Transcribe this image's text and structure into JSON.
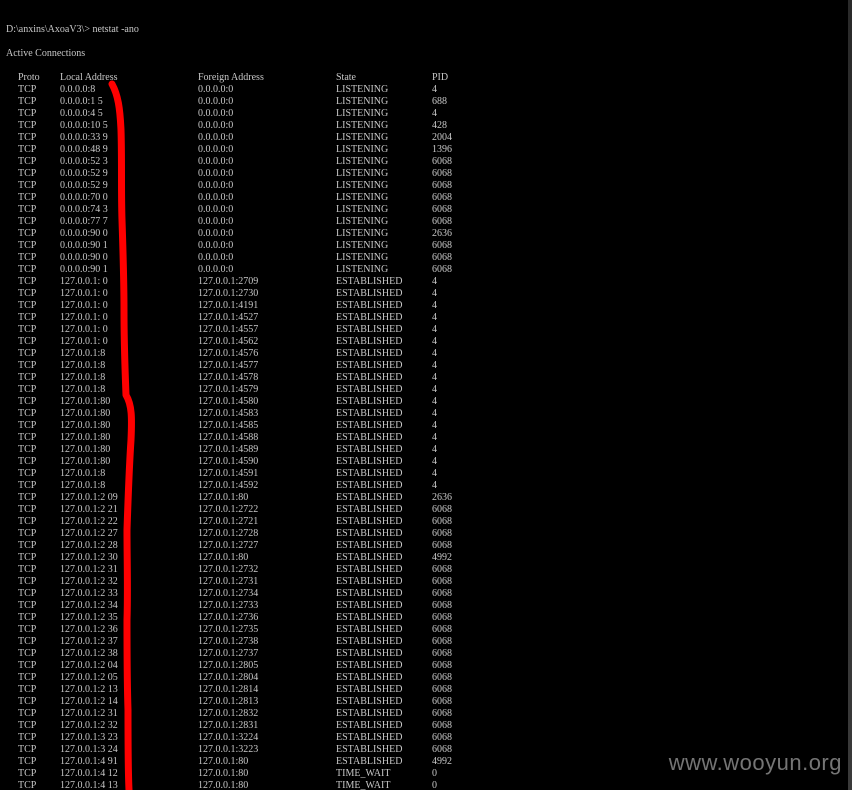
{
  "prompt_line": "D:\\anxins\\AxoaV3\\> netstat -ano",
  "section_title": "Active Connections",
  "headers": {
    "proto": "Proto",
    "local": "Local Address",
    "foreign": "Foreign Address",
    "state": "State",
    "pid": "PID"
  },
  "connections": [
    {
      "proto": "TCP",
      "local": "0.0.0.0:8",
      "foreign": "0.0.0.0:0",
      "state": "LISTENING",
      "pid": "4"
    },
    {
      "proto": "TCP",
      "local": "0.0.0.0:1 5",
      "foreign": "0.0.0.0:0",
      "state": "LISTENING",
      "pid": "688"
    },
    {
      "proto": "TCP",
      "local": "0.0.0.0:4 5",
      "foreign": "0.0.0.0:0",
      "state": "LISTENING",
      "pid": "4"
    },
    {
      "proto": "TCP",
      "local": "0.0.0.0:10 5",
      "foreign": "0.0.0.0:0",
      "state": "LISTENING",
      "pid": "428"
    },
    {
      "proto": "TCP",
      "local": "0.0.0.0:33 9",
      "foreign": "0.0.0.0:0",
      "state": "LISTENING",
      "pid": "2004"
    },
    {
      "proto": "TCP",
      "local": "0.0.0.0:48 9",
      "foreign": "0.0.0.0:0",
      "state": "LISTENING",
      "pid": "1396"
    },
    {
      "proto": "TCP",
      "local": "0.0.0.0:52 3",
      "foreign": "0.0.0.0:0",
      "state": "LISTENING",
      "pid": "6068"
    },
    {
      "proto": "TCP",
      "local": "0.0.0.0:52 9",
      "foreign": "0.0.0.0:0",
      "state": "LISTENING",
      "pid": "6068"
    },
    {
      "proto": "TCP",
      "local": "0.0.0.0:52 9",
      "foreign": "0.0.0.0:0",
      "state": "LISTENING",
      "pid": "6068"
    },
    {
      "proto": "TCP",
      "local": "0.0.0.0:70 0",
      "foreign": "0.0.0.0:0",
      "state": "LISTENING",
      "pid": "6068"
    },
    {
      "proto": "TCP",
      "local": "0.0.0.0:74 3",
      "foreign": "0.0.0.0:0",
      "state": "LISTENING",
      "pid": "6068"
    },
    {
      "proto": "TCP",
      "local": "0.0.0.0:77 7",
      "foreign": "0.0.0.0:0",
      "state": "LISTENING",
      "pid": "6068"
    },
    {
      "proto": "TCP",
      "local": "0.0.0.0:90 0",
      "foreign": "0.0.0.0:0",
      "state": "LISTENING",
      "pid": "2636"
    },
    {
      "proto": "TCP",
      "local": "0.0.0.0:90 1",
      "foreign": "0.0.0.0:0",
      "state": "LISTENING",
      "pid": "6068"
    },
    {
      "proto": "TCP",
      "local": "0.0.0.0:90 0",
      "foreign": "0.0.0.0:0",
      "state": "LISTENING",
      "pid": "6068"
    },
    {
      "proto": "TCP",
      "local": "0.0.0.0:90 1",
      "foreign": "0.0.0.0:0",
      "state": "LISTENING",
      "pid": "6068"
    },
    {
      "proto": "TCP",
      "local": "127.0.0.1: 0",
      "foreign": "127.0.0.1:2709",
      "state": "ESTABLISHED",
      "pid": "4"
    },
    {
      "proto": "TCP",
      "local": "127.0.0.1: 0",
      "foreign": "127.0.0.1:2730",
      "state": "ESTABLISHED",
      "pid": "4"
    },
    {
      "proto": "TCP",
      "local": "127.0.0.1: 0",
      "foreign": "127.0.0.1:4191",
      "state": "ESTABLISHED",
      "pid": "4"
    },
    {
      "proto": "TCP",
      "local": "127.0.0.1: 0",
      "foreign": "127.0.0.1:4527",
      "state": "ESTABLISHED",
      "pid": "4"
    },
    {
      "proto": "TCP",
      "local": "127.0.0.1: 0",
      "foreign": "127.0.0.1:4557",
      "state": "ESTABLISHED",
      "pid": "4"
    },
    {
      "proto": "TCP",
      "local": "127.0.0.1: 0",
      "foreign": "127.0.0.1:4562",
      "state": "ESTABLISHED",
      "pid": "4"
    },
    {
      "proto": "TCP",
      "local": "127.0.0.1:8",
      "foreign": "127.0.0.1:4576",
      "state": "ESTABLISHED",
      "pid": "4"
    },
    {
      "proto": "TCP",
      "local": "127.0.0.1:8",
      "foreign": "127.0.0.1:4577",
      "state": "ESTABLISHED",
      "pid": "4"
    },
    {
      "proto": "TCP",
      "local": "127.0.0.1:8",
      "foreign": "127.0.0.1:4578",
      "state": "ESTABLISHED",
      "pid": "4"
    },
    {
      "proto": "TCP",
      "local": "127.0.0.1:8",
      "foreign": "127.0.0.1:4579",
      "state": "ESTABLISHED",
      "pid": "4"
    },
    {
      "proto": "TCP",
      "local": "127.0.0.1:80",
      "foreign": "127.0.0.1:4580",
      "state": "ESTABLISHED",
      "pid": "4"
    },
    {
      "proto": "TCP",
      "local": "127.0.0.1:80",
      "foreign": "127.0.0.1:4583",
      "state": "ESTABLISHED",
      "pid": "4"
    },
    {
      "proto": "TCP",
      "local": "127.0.0.1:80",
      "foreign": "127.0.0.1:4585",
      "state": "ESTABLISHED",
      "pid": "4"
    },
    {
      "proto": "TCP",
      "local": "127.0.0.1:80",
      "foreign": "127.0.0.1:4588",
      "state": "ESTABLISHED",
      "pid": "4"
    },
    {
      "proto": "TCP",
      "local": "127.0.0.1:80",
      "foreign": "127.0.0.1:4589",
      "state": "ESTABLISHED",
      "pid": "4"
    },
    {
      "proto": "TCP",
      "local": "127.0.0.1:80",
      "foreign": "127.0.0.1:4590",
      "state": "ESTABLISHED",
      "pid": "4"
    },
    {
      "proto": "TCP",
      "local": "127.0.0.1:8",
      "foreign": "127.0.0.1:4591",
      "state": "ESTABLISHED",
      "pid": "4"
    },
    {
      "proto": "TCP",
      "local": "127.0.0.1:8",
      "foreign": "127.0.0.1:4592",
      "state": "ESTABLISHED",
      "pid": "4"
    },
    {
      "proto": "TCP",
      "local": "127.0.0.1:2 09",
      "foreign": "127.0.0.1:80",
      "state": "ESTABLISHED",
      "pid": "2636"
    },
    {
      "proto": "TCP",
      "local": "127.0.0.1:2 21",
      "foreign": "127.0.0.1:2722",
      "state": "ESTABLISHED",
      "pid": "6068"
    },
    {
      "proto": "TCP",
      "local": "127.0.0.1:2 22",
      "foreign": "127.0.0.1:2721",
      "state": "ESTABLISHED",
      "pid": "6068"
    },
    {
      "proto": "TCP",
      "local": "127.0.0.1:2 27",
      "foreign": "127.0.0.1:2728",
      "state": "ESTABLISHED",
      "pid": "6068"
    },
    {
      "proto": "TCP",
      "local": "127.0.0.1:2 28",
      "foreign": "127.0.0.1:2727",
      "state": "ESTABLISHED",
      "pid": "6068"
    },
    {
      "proto": "TCP",
      "local": "127.0.0.1:2 30",
      "foreign": "127.0.0.1:80",
      "state": "ESTABLISHED",
      "pid": "4992"
    },
    {
      "proto": "TCP",
      "local": "127.0.0.1:2 31",
      "foreign": "127.0.0.1:2732",
      "state": "ESTABLISHED",
      "pid": "6068"
    },
    {
      "proto": "TCP",
      "local": "127.0.0.1:2 32",
      "foreign": "127.0.0.1:2731",
      "state": "ESTABLISHED",
      "pid": "6068"
    },
    {
      "proto": "TCP",
      "local": "127.0.0.1:2 33",
      "foreign": "127.0.0.1:2734",
      "state": "ESTABLISHED",
      "pid": "6068"
    },
    {
      "proto": "TCP",
      "local": "127.0.0.1:2 34",
      "foreign": "127.0.0.1:2733",
      "state": "ESTABLISHED",
      "pid": "6068"
    },
    {
      "proto": "TCP",
      "local": "127.0.0.1:2 35",
      "foreign": "127.0.0.1:2736",
      "state": "ESTABLISHED",
      "pid": "6068"
    },
    {
      "proto": "TCP",
      "local": "127.0.0.1:2 36",
      "foreign": "127.0.0.1:2735",
      "state": "ESTABLISHED",
      "pid": "6068"
    },
    {
      "proto": "TCP",
      "local": "127.0.0.1:2 37",
      "foreign": "127.0.0.1:2738",
      "state": "ESTABLISHED",
      "pid": "6068"
    },
    {
      "proto": "TCP",
      "local": "127.0.0.1:2 38",
      "foreign": "127.0.0.1:2737",
      "state": "ESTABLISHED",
      "pid": "6068"
    },
    {
      "proto": "TCP",
      "local": "127.0.0.1:2 04",
      "foreign": "127.0.0.1:2805",
      "state": "ESTABLISHED",
      "pid": "6068"
    },
    {
      "proto": "TCP",
      "local": "127.0.0.1:2 05",
      "foreign": "127.0.0.1:2804",
      "state": "ESTABLISHED",
      "pid": "6068"
    },
    {
      "proto": "TCP",
      "local": "127.0.0.1:2 13",
      "foreign": "127.0.0.1:2814",
      "state": "ESTABLISHED",
      "pid": "6068"
    },
    {
      "proto": "TCP",
      "local": "127.0.0.1:2 14",
      "foreign": "127.0.0.1:2813",
      "state": "ESTABLISHED",
      "pid": "6068"
    },
    {
      "proto": "TCP",
      "local": "127.0.0.1:2 31",
      "foreign": "127.0.0.1:2832",
      "state": "ESTABLISHED",
      "pid": "6068"
    },
    {
      "proto": "TCP",
      "local": "127.0.0.1:2 32",
      "foreign": "127.0.0.1:2831",
      "state": "ESTABLISHED",
      "pid": "6068"
    },
    {
      "proto": "TCP",
      "local": "127.0.0.1:3 23",
      "foreign": "127.0.0.1:3224",
      "state": "ESTABLISHED",
      "pid": "6068"
    },
    {
      "proto": "TCP",
      "local": "127.0.0.1:3 24",
      "foreign": "127.0.0.1:3223",
      "state": "ESTABLISHED",
      "pid": "6068"
    },
    {
      "proto": "TCP",
      "local": "127.0.0.1:4 91",
      "foreign": "127.0.0.1:80",
      "state": "ESTABLISHED",
      "pid": "4992"
    },
    {
      "proto": "TCP",
      "local": "127.0.0.1:4 12",
      "foreign": "127.0.0.1:80",
      "state": "TIME_WAIT",
      "pid": "0"
    },
    {
      "proto": "TCP",
      "local": "127.0.0.1:4 13",
      "foreign": "127.0.0.1:80",
      "state": "TIME_WAIT",
      "pid": "0"
    }
  ],
  "watermark": "www.wooyun.org",
  "colors": {
    "background": "#000000",
    "text": "#c8c8c8",
    "redaction": "#ff0000",
    "watermark": "#8a8a8a"
  }
}
